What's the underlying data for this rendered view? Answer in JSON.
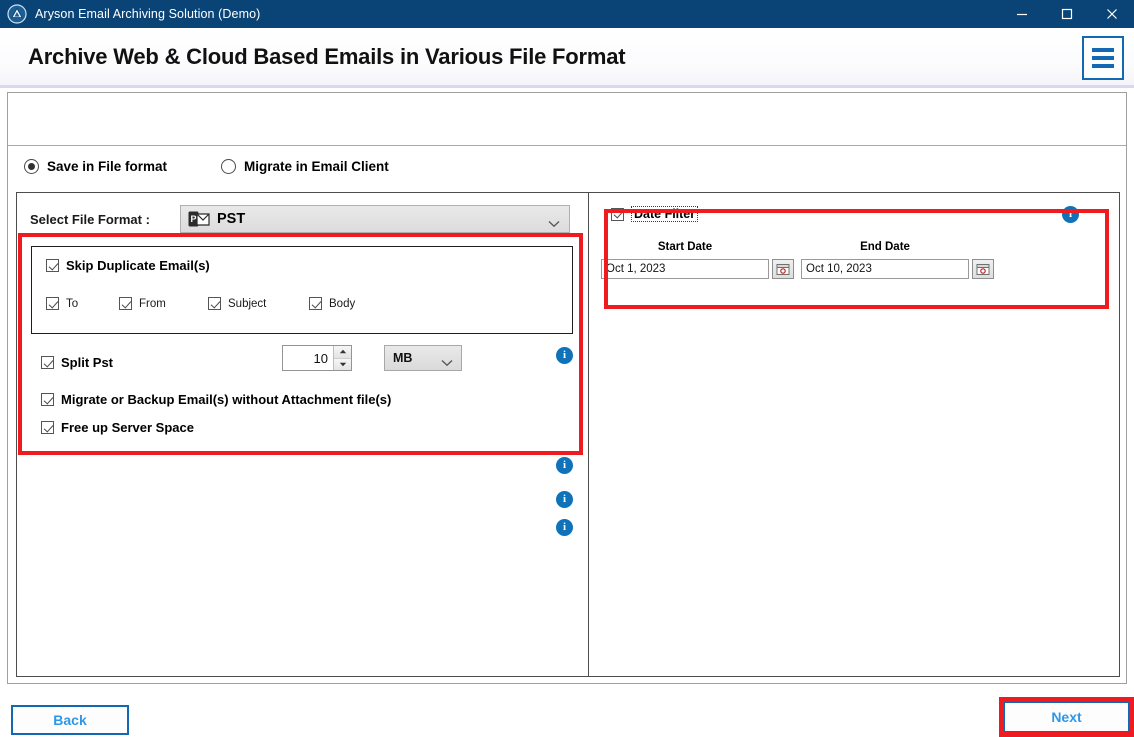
{
  "window": {
    "title": "Aryson Email Archiving Solution (Demo)",
    "logo_icon": "aryson-logo-icon",
    "minimize_icon": "minimize-icon",
    "maximize_icon": "maximize-icon",
    "close_icon": "close-icon",
    "titlebar_color": "#0a4476"
  },
  "header": {
    "page_title": "Archive Web & Cloud Based Emails in Various File Format",
    "menu_icon": "hamburger-menu-icon",
    "accent_color": "#1268b3"
  },
  "mode": {
    "options": [
      {
        "label": "Save in File format",
        "selected": true
      },
      {
        "label": "Migrate in Email Client",
        "selected": false
      }
    ]
  },
  "left_panel": {
    "file_format": {
      "label": "Select File Format  :",
      "value": "PST",
      "icon": "pst-file-icon",
      "chevron_icon": "chevron-down-icon"
    },
    "skip_duplicate": {
      "label": "Skip Duplicate Email(s)",
      "checked": true,
      "info_icon": "info-icon",
      "fields": [
        {
          "label": "To",
          "checked": true
        },
        {
          "label": "From",
          "checked": true
        },
        {
          "label": "Subject",
          "checked": true
        },
        {
          "label": "Body",
          "checked": true
        }
      ]
    },
    "split_pst": {
      "label": "Split Pst",
      "checked": true,
      "size_value": "10",
      "unit": "MB",
      "unit_chevron_icon": "chevron-down-icon",
      "spinner_up_icon": "spinner-up-icon",
      "spinner_down_icon": "spinner-down-icon",
      "info_icon": "info-icon"
    },
    "without_attachment": {
      "label": "Migrate or Backup Email(s) without Attachment file(s)",
      "checked": true,
      "info_icon": "info-icon"
    },
    "free_up_space": {
      "label": "Free up Server Space",
      "checked": true,
      "info_icon": "info-icon"
    }
  },
  "right_panel": {
    "date_filter": {
      "label": "Date Filter",
      "checked": true,
      "info_icon": "info-icon",
      "start": {
        "label": "Start Date",
        "value": "Oct 1, 2023",
        "calendar_icon": "calendar-icon"
      },
      "end": {
        "label": "End Date",
        "value": "Oct 10, 2023",
        "calendar_icon": "calendar-icon"
      }
    }
  },
  "footer": {
    "back_label": "Back",
    "next_label": "Next"
  },
  "highlights": {
    "color": "#ee1c20",
    "regions": [
      "left-options-highlight",
      "date-filter-highlight",
      "next-button-highlight"
    ]
  }
}
